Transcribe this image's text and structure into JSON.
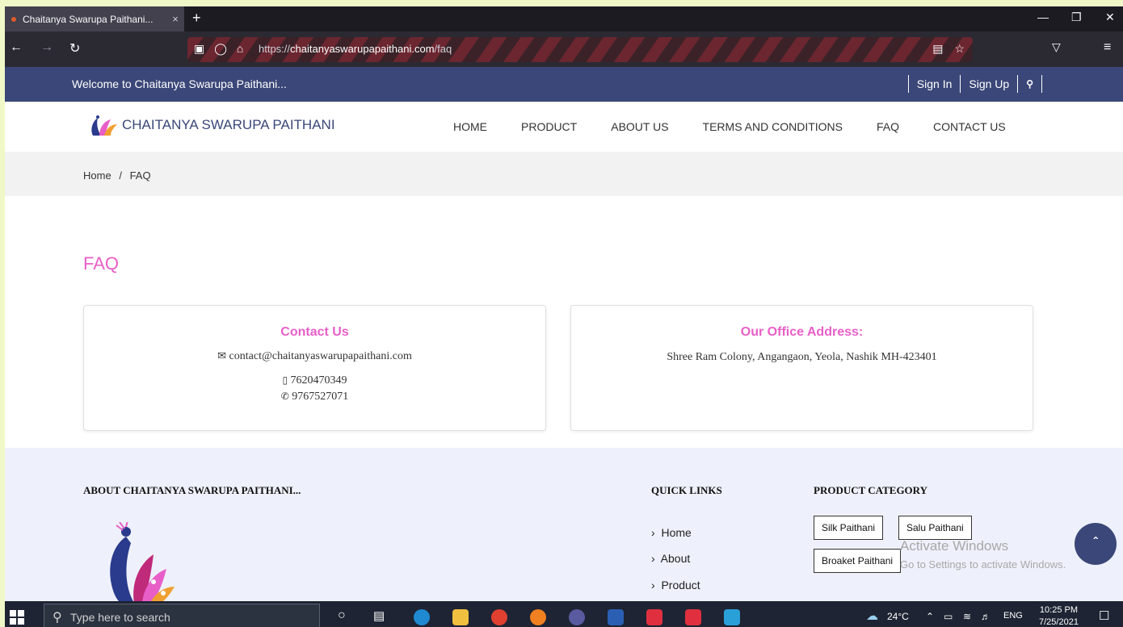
{
  "browser": {
    "tab_title": "Chaitanya Swarupa Paithani...",
    "tab_close": "×",
    "new_tab": "+",
    "url_scheme": "https://",
    "url_host": "chaitanyaswarupapaithani.com",
    "url_path": "/faq",
    "icons": [
      "back-icon",
      "forward-icon",
      "reload-icon",
      "tracking-icon",
      "shield-icon",
      "lock-icon",
      "reader-icon",
      "bookmark-star-icon",
      "pocket-icon",
      "menu-icon"
    ]
  },
  "topbar": {
    "welcome": "Welcome to Chaitanya Swarupa Paithani...",
    "sign_in": "Sign In",
    "sign_up": "Sign Up"
  },
  "header": {
    "logo_text": "CHAITANYA SWARUPA PAITHANI",
    "menu": [
      "HOME",
      "PRODUCT",
      "ABOUT US",
      "TERMS AND CONDITIONS",
      "FAQ",
      "CONTACT US"
    ]
  },
  "breadcrumb": {
    "home": "Home",
    "separator": "/",
    "current": "FAQ"
  },
  "main": {
    "title": "FAQ",
    "contact": {
      "heading": "Contact Us",
      "email": "contact@chaitanyaswarupapaithani.com",
      "mobile": "7620470349",
      "phone": "9767527071"
    },
    "office": {
      "heading": "Our Office Address:",
      "address": "Shree Ram Colony, Angangaon, Yeola, Nashik MH-423401"
    }
  },
  "footer": {
    "about_heading": "ABOUT CHAITANYA SWARUPA PAITHANI...",
    "quick_links_heading": "QUICK LINKS",
    "quick_links": [
      "Home",
      "About",
      "Product"
    ],
    "category_heading": "PRODUCT CATEGORY",
    "categories": [
      "Silk Paithani",
      "Salu Paithani",
      "Broaket Paithani"
    ]
  },
  "watermark": {
    "line1": "Activate Windows",
    "line2": "Go to Settings to activate Windows."
  },
  "taskbar": {
    "search_placeholder": "Type here to search",
    "temperature": "24°C",
    "language": "ENG",
    "time": "10:25 PM",
    "date": "7/25/2021"
  },
  "colors": {
    "brand": "#3b4778",
    "accent": "#e85fc8",
    "footer_bg": "#eef1fb"
  }
}
